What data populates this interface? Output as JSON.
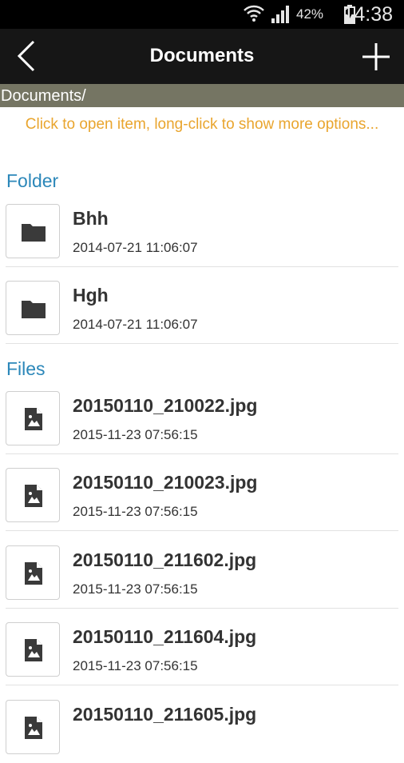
{
  "status_bar": {
    "battery_percent": "42%",
    "time": "14:38",
    "icons": [
      "wifi-icon",
      "signal-icon",
      "battery-charging-icon"
    ]
  },
  "app_bar": {
    "title": "Documents",
    "back_icon": "chevron-left-icon",
    "add_icon": "plus-icon"
  },
  "path": "Documents/",
  "hint": "Click to open item, long-click to show more options...",
  "folder_section": {
    "label": "Folder",
    "items": [
      {
        "name": "Bhh",
        "date": "2014-07-21 11:06:07",
        "icon": "folder-icon"
      },
      {
        "name": "Hgh",
        "date": "2014-07-21 11:06:07",
        "icon": "folder-icon"
      }
    ]
  },
  "files_section": {
    "label": "Files",
    "items": [
      {
        "name": "20150110_210022.jpg",
        "date": "2015-11-23 07:56:15",
        "icon": "image-file-icon"
      },
      {
        "name": "20150110_210023.jpg",
        "date": "2015-11-23 07:56:15",
        "icon": "image-file-icon"
      },
      {
        "name": "20150110_211602.jpg",
        "date": "2015-11-23 07:56:15",
        "icon": "image-file-icon"
      },
      {
        "name": "20150110_211604.jpg",
        "date": "2015-11-23 07:56:15",
        "icon": "image-file-icon"
      },
      {
        "name": "20150110_211605.jpg",
        "date": "",
        "icon": "image-file-icon"
      }
    ]
  }
}
